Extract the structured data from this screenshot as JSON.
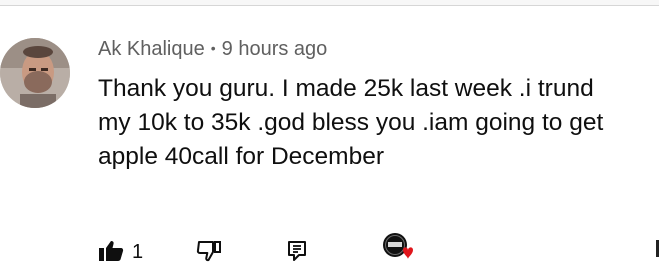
{
  "comment": {
    "author": "Ak Khalique",
    "separator": "•",
    "timestamp": "9 hours ago",
    "text_lines": [
      "Thank you guru. I made 25k last week .i trund",
      "my 10k to 35k .god bless you .iam going to get",
      "apple 40call for December"
    ],
    "like_count": "1"
  },
  "icons": {
    "like": "thumbs-up-icon",
    "dislike": "thumbs-down-icon",
    "reply": "reply-icon",
    "creator_heart": "creator-heart-icon"
  },
  "colors": {
    "meta_text": "#606060",
    "body_text": "#0f0f0f",
    "heart": "#e0161c"
  }
}
